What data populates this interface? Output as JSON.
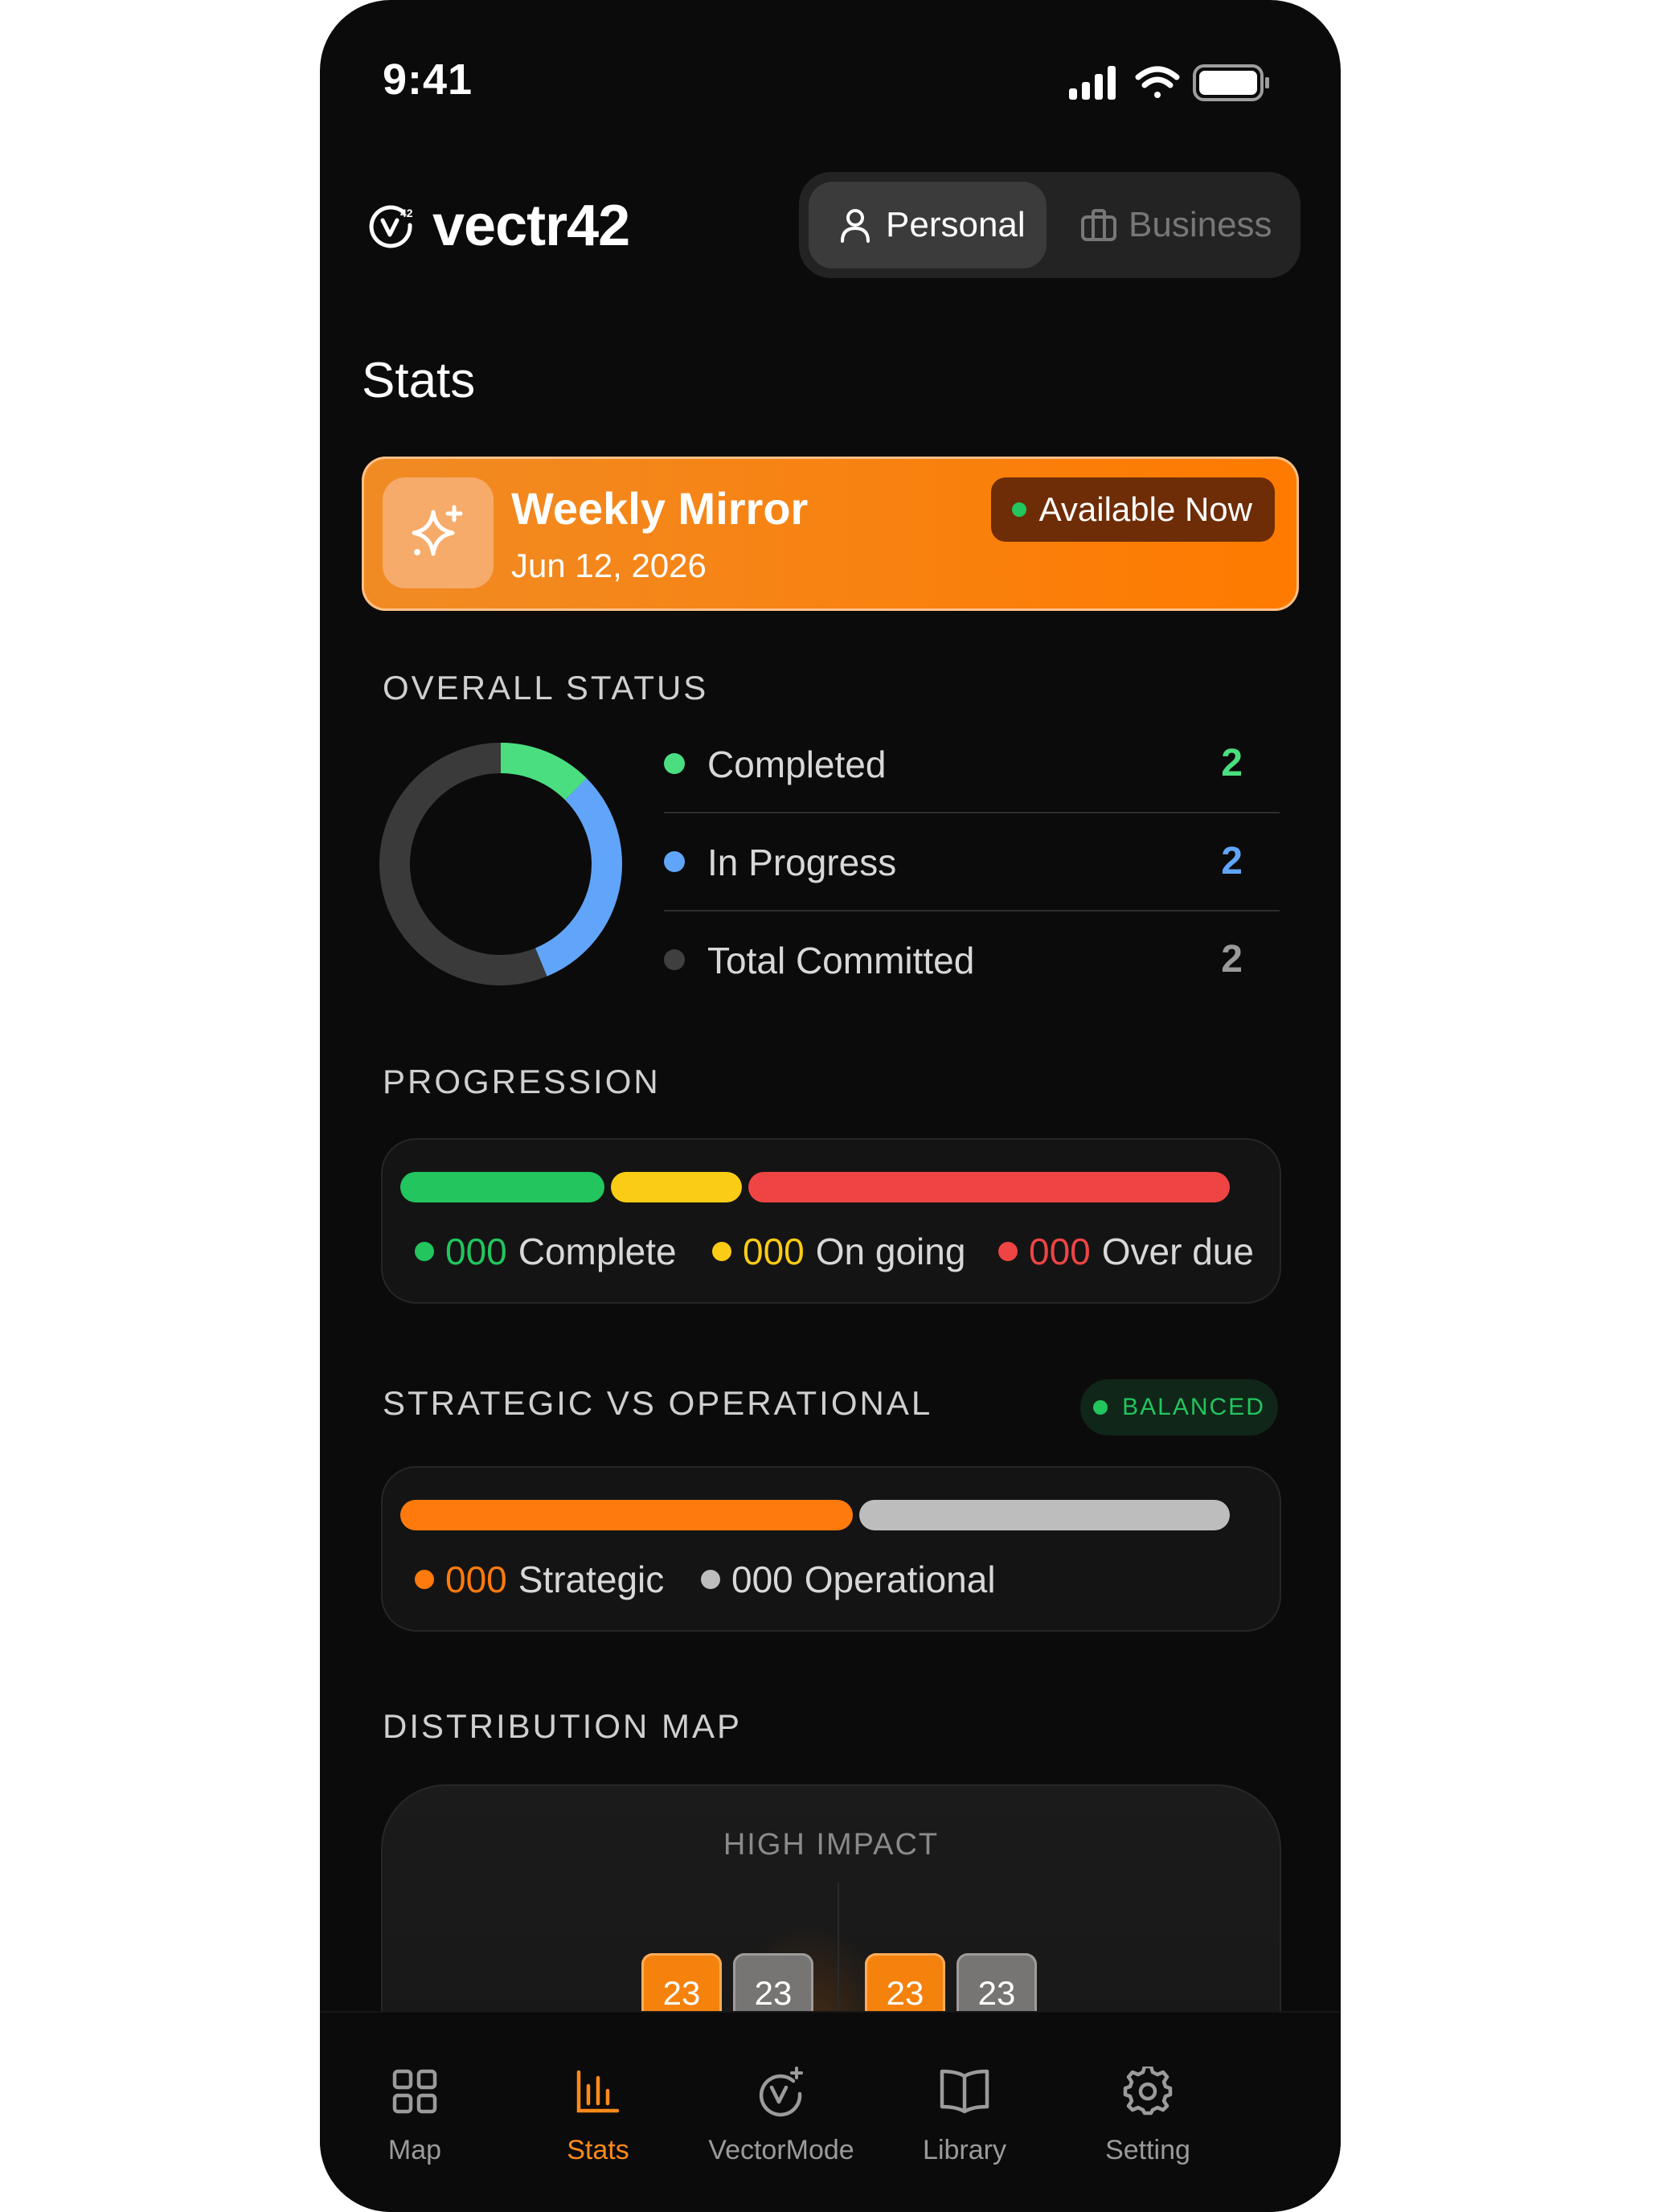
{
  "status_bar": {
    "time": "9:41"
  },
  "brand": {
    "name": "vectr42",
    "logo_mark": "42"
  },
  "mode_switch": {
    "personal": "Personal",
    "business": "Business",
    "active": "Personal"
  },
  "page": {
    "title": "Stats"
  },
  "banner": {
    "title": "Weekly Mirror",
    "date": "Jun 12, 2026",
    "badge": "Available Now",
    "icon": "sparkle-icon"
  },
  "overall_status": {
    "label": "OVERALL STATUS",
    "rows": [
      {
        "label": "Completed",
        "value": "2",
        "color": "#4ade80"
      },
      {
        "label": "In Progress",
        "value": "2",
        "color": "#60a5fa"
      },
      {
        "label": "Total Committed",
        "value": "2",
        "color": "#9a9a9a"
      }
    ],
    "donut": {
      "completed_fraction": 0.125,
      "in_progress_fraction": 0.3125,
      "track_color": "#3a3a3a"
    }
  },
  "progression": {
    "label": "PROGRESSION",
    "segments": [
      {
        "label": "Complete",
        "value": "000",
        "color": "#22c55e",
        "fraction": 0.25
      },
      {
        "label": "On going",
        "value": "000",
        "color": "#facc15",
        "fraction": 0.16
      },
      {
        "label": "Over due",
        "value": "000",
        "color": "#ef4444",
        "fraction": 0.59
      }
    ]
  },
  "strategic_vs_operational": {
    "label": "STRATEGIC VS OPERATIONAL",
    "badge": "BALANCED",
    "segments": [
      {
        "label": "Strategic",
        "value": "000",
        "color": "#ff7a0d",
        "fraction": 0.55
      },
      {
        "label": "Operational",
        "value": "000",
        "color": "#bdbdbd",
        "fraction": 0.45
      }
    ]
  },
  "distribution": {
    "label": "DISTRIBUTION MAP",
    "axis_label": "HIGH IMPACT",
    "boxes": [
      {
        "value": "23",
        "tone": "orange"
      },
      {
        "value": "23",
        "tone": "gray"
      },
      {
        "value": "23",
        "tone": "orange"
      },
      {
        "value": "23",
        "tone": "gray"
      }
    ]
  },
  "tabs": [
    {
      "label": "Map",
      "icon": "grid-icon"
    },
    {
      "label": "Stats",
      "icon": "bar-chart-icon"
    },
    {
      "label": "VectorMode",
      "icon": "vector-mode-icon"
    },
    {
      "label": "Library",
      "icon": "book-icon"
    },
    {
      "label": "Setting",
      "icon": "gear-icon"
    }
  ],
  "active_tab": "Stats",
  "colors": {
    "accent": "#ff8a1a",
    "background": "#0b0b0b"
  }
}
